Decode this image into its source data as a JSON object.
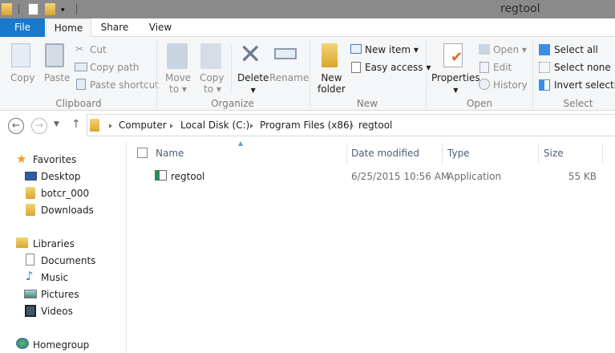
{
  "window": {
    "title": "regtool"
  },
  "tabs": {
    "file": "File",
    "home": "Home",
    "share": "Share",
    "view": "View"
  },
  "ribbon": {
    "clipboard": {
      "label": "Clipboard",
      "copy": "Copy",
      "paste": "Paste",
      "cut": "Cut",
      "copy_path": "Copy path",
      "paste_shortcut": "Paste shortcut"
    },
    "organize": {
      "label": "Organize",
      "move_to": "Move",
      "move_to2": "to",
      "copy_to": "Copy",
      "copy_to2": "to",
      "delete": "Delete",
      "rename": "Rename"
    },
    "new": {
      "label": "New",
      "new_folder": "New",
      "new_folder2": "folder",
      "new_item": "New item",
      "easy_access": "Easy access"
    },
    "open": {
      "label": "Open",
      "properties": "Properties",
      "open": "Open",
      "edit": "Edit",
      "history": "History"
    },
    "select": {
      "label": "Select",
      "select_all": "Select all",
      "select_none": "Select none",
      "invert": "Invert selection"
    }
  },
  "address": {
    "crumbs": [
      "Computer",
      "Local Disk (C:)",
      "Program Files (x86)",
      "regtool"
    ]
  },
  "nav": {
    "favorites": "Favorites",
    "desktop": "Desktop",
    "user": "botcr_000",
    "downloads": "Downloads",
    "libraries": "Libraries",
    "documents": "Documents",
    "music": "Music",
    "pictures": "Pictures",
    "videos": "Videos",
    "homegroup": "Homegroup"
  },
  "columns": {
    "name": "Name",
    "date": "Date modified",
    "type": "Type",
    "size": "Size"
  },
  "files": [
    {
      "name": "regtool",
      "date": "6/25/2015 10:56 AM",
      "type": "Application",
      "size": "55 KB"
    }
  ]
}
